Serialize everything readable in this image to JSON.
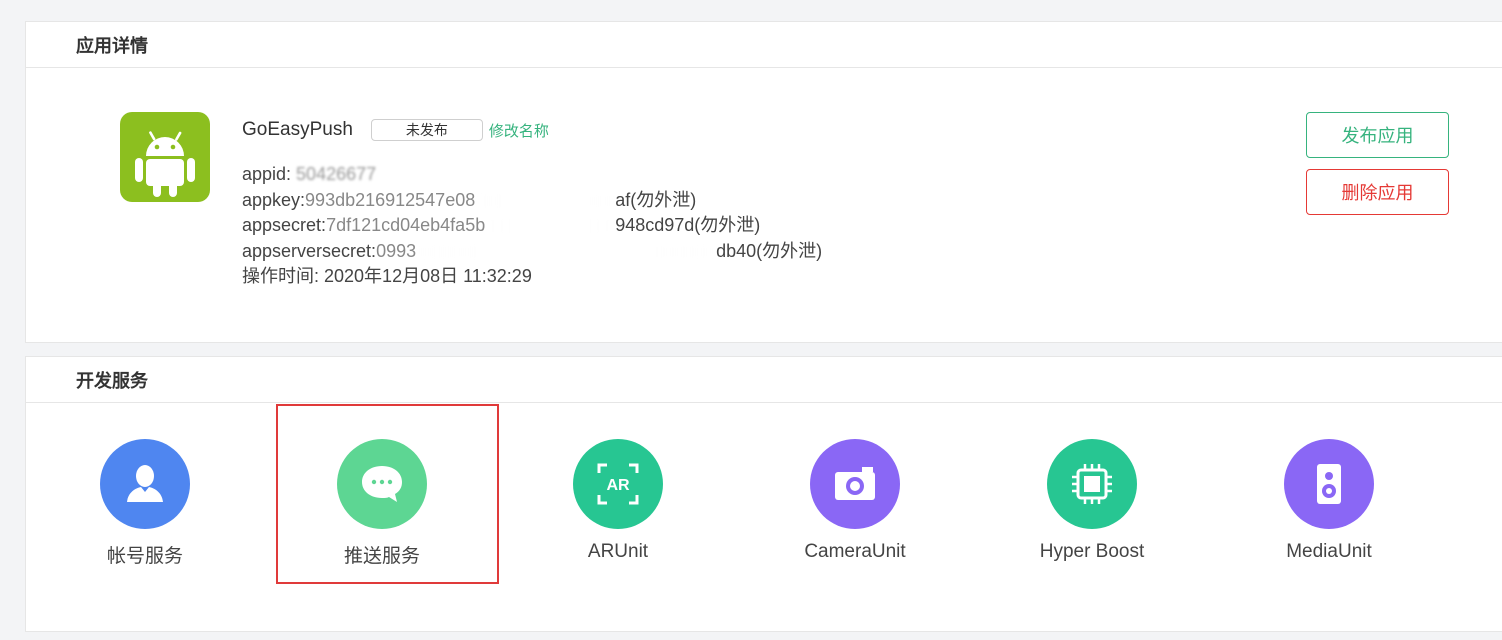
{
  "detail": {
    "title": "应用详情",
    "app_name": "GoEasyPush",
    "status": "未发布",
    "rename_link": "修改名称",
    "appid_label": "appid: ",
    "appid_value": "50426677",
    "appkey_label": "appkey:",
    "appkey_prefix": "993db216912547e08",
    "appkey_suffix": "af",
    "appsecret_label": "appsecret:",
    "appsecret_prefix": "7df121cd04eb4fa5b",
    "appsecret_suffix": "948cd97d",
    "appserversecret_label": "appserversecret:",
    "appserversecret_prefix": "0993",
    "appserversecret_suffix": "db40",
    "leak_warning": "(勿外泄)",
    "operation_time_label": "操作时间: ",
    "operation_time_value": "2020年12月08日 11:32:29",
    "publish_button": "发布应用",
    "delete_button": "删除应用"
  },
  "services": {
    "title": "开发服务",
    "items": [
      {
        "label": "帐号服务",
        "icon": "user-icon",
        "color": "#4f86f0"
      },
      {
        "label": "推送服务",
        "icon": "chat-bubble-icon",
        "color": "#5dd693"
      },
      {
        "label": "ARUnit",
        "icon": "ar-icon",
        "color": "#27c692"
      },
      {
        "label": "CameraUnit",
        "icon": "camera-icon",
        "color": "#8a67f5"
      },
      {
        "label": "Hyper Boost",
        "icon": "chip-icon",
        "color": "#27c692"
      },
      {
        "label": "MediaUnit",
        "icon": "speaker-icon",
        "color": "#8a67f5"
      }
    ]
  },
  "colors": {
    "accent_green": "#36b37e",
    "danger_red": "#e53935",
    "android_green": "#8cbf1f",
    "highlight_red": "#e03a3a"
  }
}
